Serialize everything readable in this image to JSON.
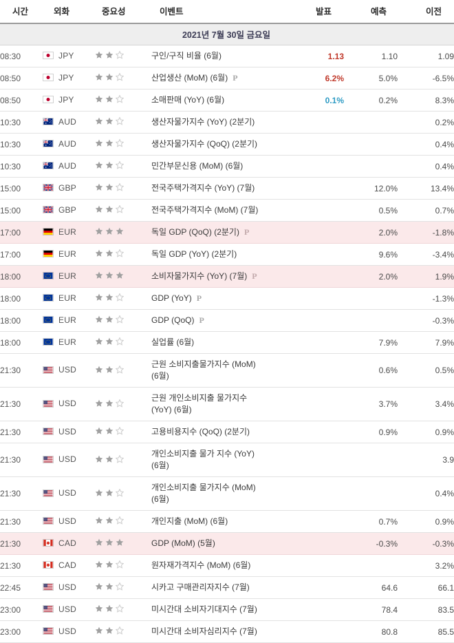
{
  "header": {
    "columns": [
      {
        "key": "time",
        "label": "시간"
      },
      {
        "key": "currency",
        "label": "외화"
      },
      {
        "key": "impact",
        "label": "중요성"
      },
      {
        "key": "event",
        "label": "이벤트"
      },
      {
        "key": "actual",
        "label": "발표"
      },
      {
        "key": "forecast",
        "label": "예측"
      },
      {
        "key": "previous",
        "label": "이전"
      }
    ]
  },
  "date_group": {
    "label": "2021년 7월 30일 금요일"
  },
  "colors": {
    "up": "#c0392b",
    "down": "#2e9bc4",
    "neutral": "#4a4a4a",
    "highlight_row": "#fbe9ea",
    "date_band": "#eeeeee",
    "star_filled": "#a0a0a0",
    "star_empty": "#cfcfcf"
  },
  "legend": {
    "preliminary_marker": "P"
  },
  "rows": [
    {
      "time": "08:30",
      "currency": "JPY",
      "flag": "jp-flag-icon",
      "stars": 2,
      "event": "구인/구직 비율 (6월)",
      "preliminary": false,
      "actual": "1.13",
      "actual_dir": "up",
      "forecast": "1.10",
      "previous": "1.09",
      "highlight": false
    },
    {
      "time": "08:50",
      "currency": "JPY",
      "flag": "jp-flag-icon",
      "stars": 2,
      "event": "산업생산 (MoM) (6월)",
      "preliminary": true,
      "actual": "6.2%",
      "actual_dir": "up",
      "forecast": "5.0%",
      "previous": "-6.5%",
      "highlight": false
    },
    {
      "time": "08:50",
      "currency": "JPY",
      "flag": "jp-flag-icon",
      "stars": 2,
      "event": "소매판매 (YoY) (6월)",
      "preliminary": false,
      "actual": "0.1%",
      "actual_dir": "down",
      "forecast": "0.2%",
      "previous": "8.3%",
      "highlight": false
    },
    {
      "time": "10:30",
      "currency": "AUD",
      "flag": "au-flag-icon",
      "stars": 2,
      "event": "생산자물가지수 (YoY) (2분기)",
      "preliminary": false,
      "actual": "",
      "actual_dir": "flat",
      "forecast": "",
      "previous": "0.2%",
      "highlight": false
    },
    {
      "time": "10:30",
      "currency": "AUD",
      "flag": "au-flag-icon",
      "stars": 2,
      "event": "생산자물가지수 (QoQ) (2분기)",
      "preliminary": false,
      "actual": "",
      "actual_dir": "flat",
      "forecast": "",
      "previous": "0.4%",
      "highlight": false
    },
    {
      "time": "10:30",
      "currency": "AUD",
      "flag": "au-flag-icon",
      "stars": 2,
      "event": "민간부문신용 (MoM) (6월)",
      "preliminary": false,
      "actual": "",
      "actual_dir": "flat",
      "forecast": "",
      "previous": "0.4%",
      "highlight": false
    },
    {
      "time": "15:00",
      "currency": "GBP",
      "flag": "gb-flag-icon",
      "stars": 2,
      "event": "전국주택가격지수 (YoY) (7월)",
      "preliminary": false,
      "actual": "",
      "actual_dir": "flat",
      "forecast": "12.0%",
      "previous": "13.4%",
      "highlight": false
    },
    {
      "time": "15:00",
      "currency": "GBP",
      "flag": "gb-flag-icon",
      "stars": 2,
      "event": "전국주택가격지수 (MoM) (7월)",
      "preliminary": false,
      "actual": "",
      "actual_dir": "flat",
      "forecast": "0.5%",
      "previous": "0.7%",
      "highlight": false
    },
    {
      "time": "17:00",
      "currency": "EUR",
      "flag": "de-flag-icon",
      "stars": 3,
      "event": "독일 GDP (QoQ) (2분기)",
      "preliminary": true,
      "actual": "",
      "actual_dir": "flat",
      "forecast": "2.0%",
      "previous": "-1.8%",
      "highlight": true
    },
    {
      "time": "17:00",
      "currency": "EUR",
      "flag": "de-flag-icon",
      "stars": 2,
      "event": "독일 GDP (YoY) (2분기)",
      "preliminary": false,
      "actual": "",
      "actual_dir": "flat",
      "forecast": "9.6%",
      "previous": "-3.4%",
      "highlight": false
    },
    {
      "time": "18:00",
      "currency": "EUR",
      "flag": "eu-flag-icon",
      "stars": 3,
      "event": "소비자물가지수 (YoY) (7월)",
      "preliminary": true,
      "actual": "",
      "actual_dir": "flat",
      "forecast": "2.0%",
      "previous": "1.9%",
      "highlight": true
    },
    {
      "time": "18:00",
      "currency": "EUR",
      "flag": "eu-flag-icon",
      "stars": 2,
      "event": "GDP (YoY)",
      "preliminary": true,
      "actual": "",
      "actual_dir": "flat",
      "forecast": "",
      "previous": "-1.3%",
      "highlight": false
    },
    {
      "time": "18:00",
      "currency": "EUR",
      "flag": "eu-flag-icon",
      "stars": 2,
      "event": "GDP (QoQ)",
      "preliminary": true,
      "actual": "",
      "actual_dir": "flat",
      "forecast": "",
      "previous": "-0.3%",
      "highlight": false
    },
    {
      "time": "18:00",
      "currency": "EUR",
      "flag": "eu-flag-icon",
      "stars": 2,
      "event": "실업률 (6월)",
      "preliminary": false,
      "actual": "",
      "actual_dir": "flat",
      "forecast": "7.9%",
      "previous": "7.9%",
      "highlight": false
    },
    {
      "time": "21:30",
      "currency": "USD",
      "flag": "us-flag-icon",
      "stars": 2,
      "event": "근원 소비지출물가지수 (MoM)\n(6월)",
      "preliminary": false,
      "actual": "",
      "actual_dir": "flat",
      "forecast": "0.6%",
      "previous": "0.5%",
      "highlight": false
    },
    {
      "time": "21:30",
      "currency": "USD",
      "flag": "us-flag-icon",
      "stars": 2,
      "event": "근원 개인소비지출 물가지수\n(YoY) (6월)",
      "preliminary": false,
      "actual": "",
      "actual_dir": "flat",
      "forecast": "3.7%",
      "previous": "3.4%",
      "highlight": false
    },
    {
      "time": "21:30",
      "currency": "USD",
      "flag": "us-flag-icon",
      "stars": 2,
      "event": "고용비용지수 (QoQ) (2분기)",
      "preliminary": false,
      "actual": "",
      "actual_dir": "flat",
      "forecast": "0.9%",
      "previous": "0.9%",
      "highlight": false
    },
    {
      "time": "21:30",
      "currency": "USD",
      "flag": "us-flag-icon",
      "stars": 2,
      "event": "개인소비지출 물가 지수 (YoY)\n(6월)",
      "preliminary": false,
      "actual": "",
      "actual_dir": "flat",
      "forecast": "",
      "previous": "3.9",
      "highlight": false
    },
    {
      "time": "21:30",
      "currency": "USD",
      "flag": "us-flag-icon",
      "stars": 2,
      "event": "개인소비지출 물가지수 (MoM)\n(6월)",
      "preliminary": false,
      "actual": "",
      "actual_dir": "flat",
      "forecast": "",
      "previous": "0.4%",
      "highlight": false
    },
    {
      "time": "21:30",
      "currency": "USD",
      "flag": "us-flag-icon",
      "stars": 2,
      "event": "개인지출 (MoM) (6월)",
      "preliminary": false,
      "actual": "",
      "actual_dir": "flat",
      "forecast": "0.7%",
      "previous": "0.9%",
      "highlight": false
    },
    {
      "time": "21:30",
      "currency": "CAD",
      "flag": "ca-flag-icon",
      "stars": 3,
      "event": "GDP (MoM) (5월)",
      "preliminary": false,
      "actual": "",
      "actual_dir": "flat",
      "forecast": "-0.3%",
      "previous": "-0.3%",
      "highlight": true
    },
    {
      "time": "21:30",
      "currency": "CAD",
      "flag": "ca-flag-icon",
      "stars": 2,
      "event": "원자재가격지수 (MoM) (6월)",
      "preliminary": false,
      "actual": "",
      "actual_dir": "flat",
      "forecast": "",
      "previous": "3.2%",
      "highlight": false
    },
    {
      "time": "22:45",
      "currency": "USD",
      "flag": "us-flag-icon",
      "stars": 2,
      "event": "시카고 구매관리자지수 (7월)",
      "preliminary": false,
      "actual": "",
      "actual_dir": "flat",
      "forecast": "64.6",
      "previous": "66.1",
      "highlight": false
    },
    {
      "time": "23:00",
      "currency": "USD",
      "flag": "us-flag-icon",
      "stars": 2,
      "event": "미시간대 소비자기대지수 (7월)",
      "preliminary": false,
      "actual": "",
      "actual_dir": "flat",
      "forecast": "78.4",
      "previous": "83.5",
      "highlight": false
    },
    {
      "time": "23:00",
      "currency": "USD",
      "flag": "us-flag-icon",
      "stars": 2,
      "event": "미시간대 소비자심리지수 (7월)",
      "preliminary": false,
      "actual": "",
      "actual_dir": "flat",
      "forecast": "80.8",
      "previous": "85.5",
      "highlight": false
    }
  ]
}
